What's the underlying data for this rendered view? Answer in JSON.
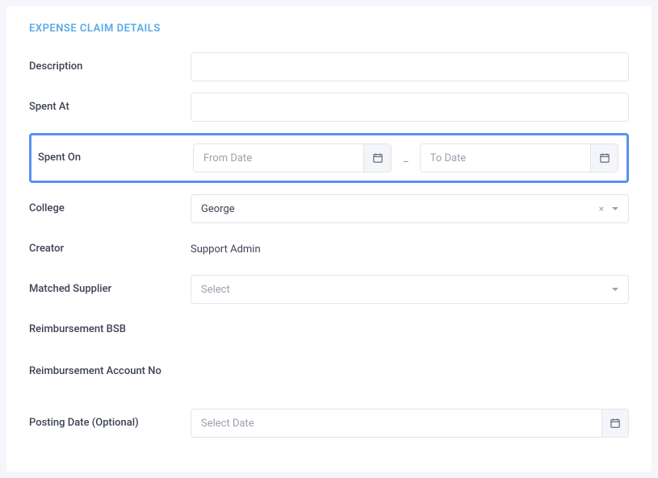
{
  "section_title": "EXPENSE CLAIM DETAILS",
  "fields": {
    "description_label": "Description",
    "spent_at_label": "Spent At",
    "spent_on_label": "Spent On",
    "from_date_placeholder": "From Date",
    "to_date_placeholder": "To Date",
    "range_separator": "_",
    "college_label": "College",
    "college_value": "George",
    "clear_symbol": "×",
    "creator_label": "Creator",
    "creator_value": "Support Admin",
    "matched_supplier_label": "Matched Supplier",
    "matched_supplier_placeholder": "Select",
    "reimbursement_bsb_label": "Reimbursement BSB",
    "reimbursement_account_no_label": "Reimbursement Account No",
    "posting_date_label": "Posting Date (Optional)",
    "posting_date_placeholder": "Select Date"
  }
}
